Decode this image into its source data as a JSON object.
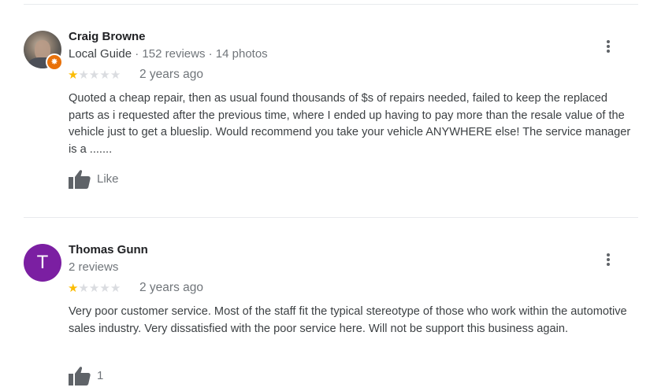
{
  "reviews": [
    {
      "author": "Craig Browne",
      "meta_prefix": "Local Guide",
      "meta_reviews": "152 reviews",
      "meta_photos": "14 photos",
      "separator": "·",
      "rating": 1,
      "max_rating": 5,
      "date": "2 years ago",
      "text": "Quoted a cheap repair, then as usual found thousands of $s of repairs needed, failed to keep the replaced parts as i requested after the previous time, where I ended up having to pay more than the resale value of the vehicle just to get a blueslip. Would recommend you take your vehicle ANYWHERE else! The service manager is a .......",
      "like_label": "Like",
      "avatar_icon": "person-photo",
      "badge_icon": "local-guide-star-icon"
    },
    {
      "author": "Thomas Gunn",
      "meta_reviews": "2 reviews",
      "avatar_letter": "T",
      "rating": 1,
      "max_rating": 5,
      "date": "2 years ago",
      "text": "Very poor customer service. Most of the staff fit the typical stereotype of those who work within the automotive sales industry. Very dissatisfied with the poor service here. Will not be support this business again.",
      "like_label": "1"
    }
  ],
  "colors": {
    "star_on": "#fbbc04",
    "star_off": "#dadce0",
    "avatar_letter_bg": "#7b1fa2",
    "local_guide_badge": "#e8710a",
    "icon_gray": "#5f6368"
  },
  "icons": {
    "like": "thumbs-up-icon",
    "more": "more-vert-icon",
    "star": "star-icon"
  }
}
